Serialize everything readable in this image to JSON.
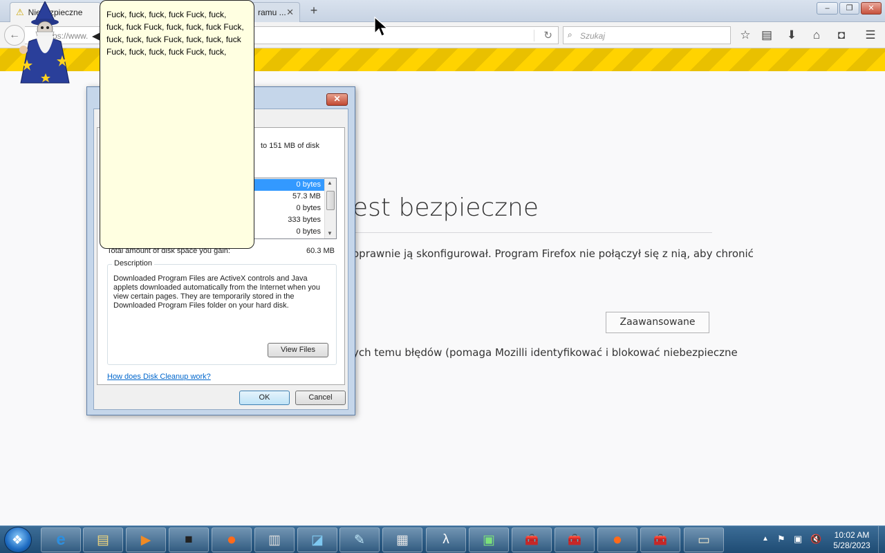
{
  "browser": {
    "tabs": [
      {
        "label": "Niebezpieczne",
        "active": true
      },
      {
        "label": "ramu ...",
        "active": false
      }
    ],
    "url_partial": "ps://www.",
    "search_placeholder": "Szukaj",
    "toolbar_icons": [
      "star-icon",
      "reading-list-icon",
      "download-icon",
      "home-icon",
      "pocket-icon",
      "menu-icon"
    ]
  },
  "page": {
    "heading": "est bezpieczne",
    "text1": "oprawnie ją skonfigurował. Program Firefox nie połączył się z nią, aby chronić",
    "advanced_button": "Zaawansowane",
    "text2": "ych temu błędów (pomaga Mozilli identyfikować i blokować niebezpieczne",
    "warning_colors": [
      "#ffd300",
      "#e9c000"
    ]
  },
  "dialog": {
    "disk_text": "to 151 MB of disk",
    "files": [
      {
        "size": "0 bytes",
        "selected": true
      },
      {
        "size": "57.3 MB",
        "selected": false
      },
      {
        "size": "0 bytes",
        "selected": false
      },
      {
        "size": "333 bytes",
        "selected": false
      },
      {
        "size": "0 bytes",
        "selected": false
      }
    ],
    "total_label": "Total amount of disk space you gain:",
    "total_value": "60.3 MB",
    "description_label": "Description",
    "description_text": "Downloaded Program Files are ActiveX controls and Java applets downloaded automatically from the Internet when you view certain pages. They are temporarily stored in the Downloaded Program Files folder on your hard disk.",
    "view_files": "View Files",
    "help_link": "How does Disk Cleanup work?",
    "ok": "OK",
    "cancel": "Cancel"
  },
  "agent": {
    "bubble_text": "Fuck, fuck, fuck, fuck Fuck, fuck, fuck, fuck Fuck, fuck, fuck, fuck Fuck, fuck, fuck, fuck Fuck, fuck, fuck, fuck Fuck, fuck, fuck, fuck Fuck, fuck,"
  },
  "taskbar": {
    "apps": [
      {
        "name": "internet-explorer-icon",
        "glyph": "e"
      },
      {
        "name": "explorer-folder-icon",
        "glyph": "▤"
      },
      {
        "name": "media-player-icon",
        "glyph": "▶"
      },
      {
        "name": "app-icon",
        "glyph": "■"
      },
      {
        "name": "firefox-icon",
        "glyph": "●"
      },
      {
        "name": "server-icon",
        "glyph": "▥"
      },
      {
        "name": "app-window-icon",
        "glyph": "◪"
      },
      {
        "name": "notepad-icon",
        "glyph": "✎"
      },
      {
        "name": "calculator-icon",
        "glyph": "▦"
      },
      {
        "name": "lambda-icon",
        "glyph": "λ"
      },
      {
        "name": "terminal-icon",
        "glyph": "▣"
      },
      {
        "name": "toolbox-icon",
        "glyph": "🧰"
      },
      {
        "name": "toolbox-icon",
        "glyph": "🧰"
      },
      {
        "name": "firefox-icon",
        "glyph": "●"
      },
      {
        "name": "toolbox-icon",
        "glyph": "🧰"
      },
      {
        "name": "cabinet-icon",
        "glyph": "▭"
      }
    ],
    "clock_time": "10:02 AM",
    "clock_date": "5/28/2023"
  }
}
